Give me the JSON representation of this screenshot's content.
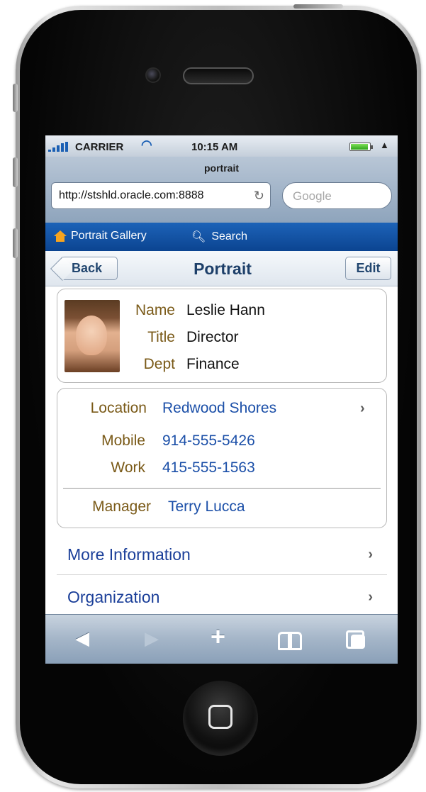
{
  "status_bar": {
    "carrier": "CARRIER",
    "time": "10:15 AM"
  },
  "browser": {
    "page_title": "portrait",
    "url": "http://stshld.oracle.com:8888",
    "search_placeholder": "Google"
  },
  "app_nav": {
    "home_label": "Portrait Gallery",
    "search_label": "Search"
  },
  "header": {
    "back_label": "Back",
    "title": "Portrait",
    "edit_label": "Edit"
  },
  "profile": {
    "name_label": "Name",
    "name": "Leslie Hann",
    "title_label": "Title",
    "title": "Director",
    "dept_label": "Dept",
    "dept": "Finance"
  },
  "contact": {
    "location_label": "Location",
    "location": "Redwood Shores",
    "mobile_label": "Mobile",
    "mobile": "914-555-5426",
    "work_label": "Work",
    "work": "415-555-1563",
    "manager_label": "Manager",
    "manager": "Terry Lucca"
  },
  "nav_rows": [
    {
      "label": "More Information"
    },
    {
      "label": "Organization"
    }
  ],
  "toolbar": {
    "back_icon": "back-arrow-icon",
    "forward_icon": "forward-arrow-icon",
    "add_icon": "plus-icon",
    "bookmarks_icon": "book-icon",
    "pages_icon": "pages-icon"
  },
  "colors": {
    "nav_blue": "#0b4491",
    "link_blue": "#1b4fa8",
    "label_brown": "#7a5a18"
  }
}
